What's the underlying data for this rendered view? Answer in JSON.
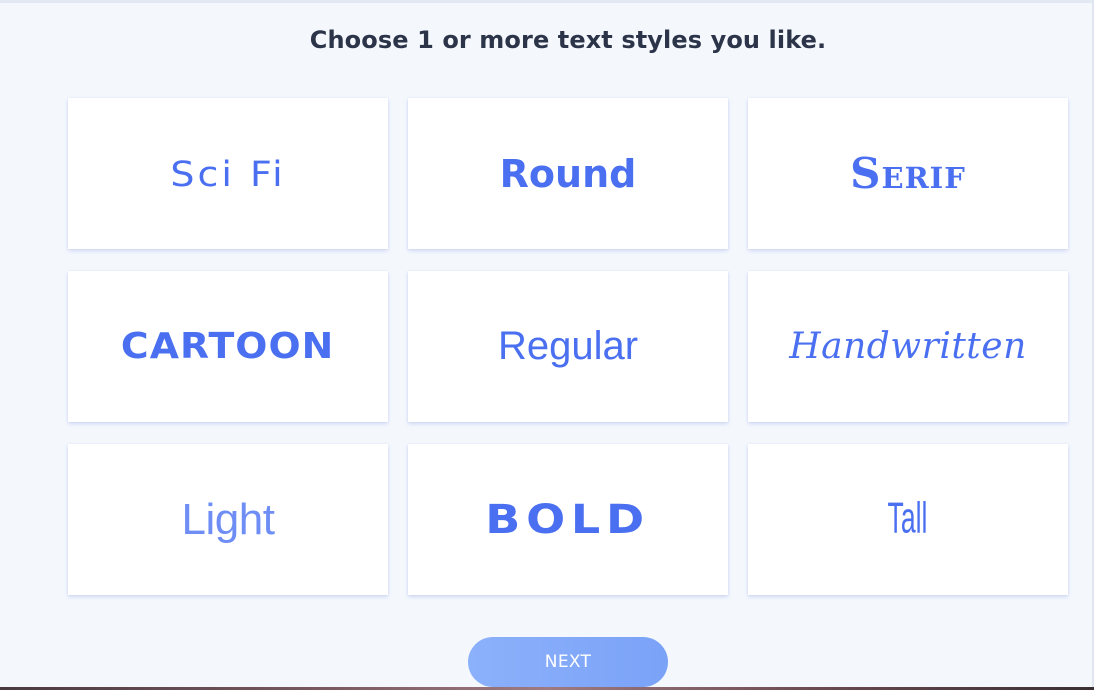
{
  "title": "Choose 1 or more text styles you like.",
  "styles": [
    {
      "label": "Sci Fi"
    },
    {
      "label": "Round"
    },
    {
      "label": "Serif"
    },
    {
      "label": "CARTOON"
    },
    {
      "label": "Regular"
    },
    {
      "label": "Handwritten"
    },
    {
      "label": "Light"
    },
    {
      "label": "BOLD"
    },
    {
      "label": "Tall"
    }
  ],
  "next_button": {
    "label": "NEXT"
  },
  "colors": {
    "accent": "#4a6ff0",
    "background": "#f4f8fd",
    "title": "#2b3448",
    "button": "#7aa2f7"
  }
}
